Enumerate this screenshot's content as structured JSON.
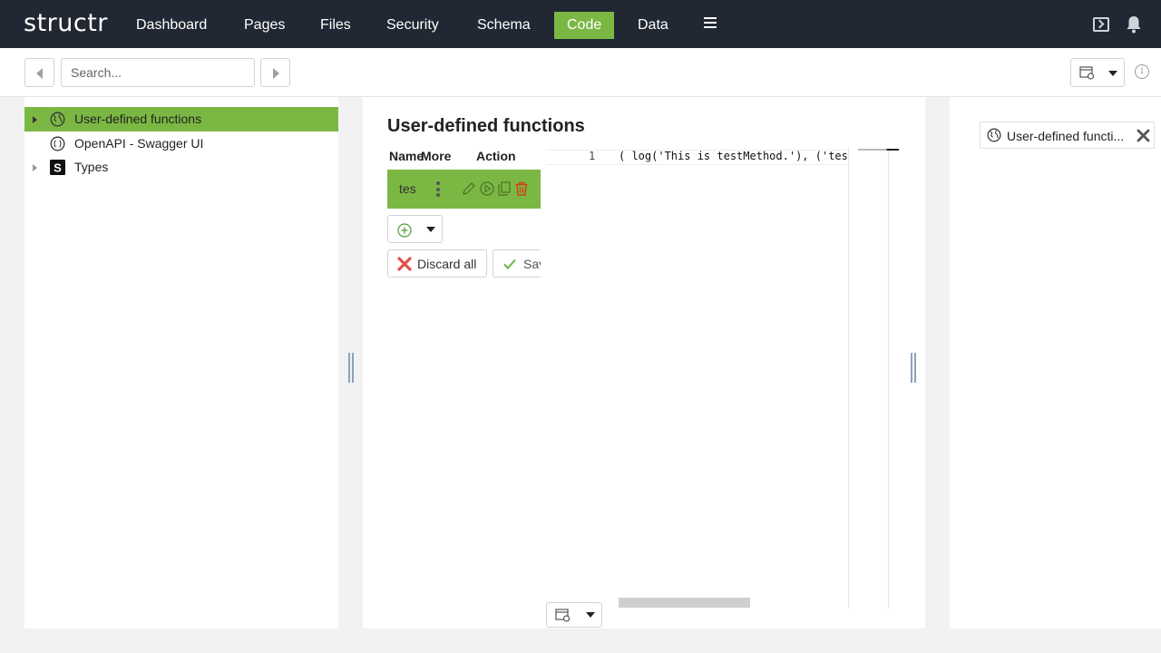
{
  "header": {
    "logo": "structr",
    "nav": [
      "Dashboard",
      "Pages",
      "Files",
      "Security",
      "Schema",
      "Code",
      "Data"
    ],
    "active_nav": "Code"
  },
  "toolbar": {
    "search_placeholder": "Search..."
  },
  "tree": {
    "items": [
      {
        "label": "User-defined functions",
        "icon": "globe-icon",
        "selected": true,
        "expander": "solid"
      },
      {
        "label": "OpenAPI - Swagger UI",
        "icon": "openapi-icon",
        "selected": false,
        "expander": "none"
      },
      {
        "label": "Types",
        "icon": "structr-s-icon",
        "selected": false,
        "expander": "hollow"
      }
    ]
  },
  "main": {
    "title": "User-defined functions",
    "columns": [
      "Name",
      "More",
      "Action"
    ],
    "method": {
      "name": "tes"
    },
    "discard_label": "Discard all",
    "save_label": "Save"
  },
  "editor": {
    "line_number": "1",
    "code": "( log('This is testMethod.'), ('test"
  },
  "right": {
    "tab_label": "User-defined functi..."
  },
  "colors": {
    "header_bg": "#212833",
    "accent": "#7bb843",
    "delete": "#d0421b"
  }
}
